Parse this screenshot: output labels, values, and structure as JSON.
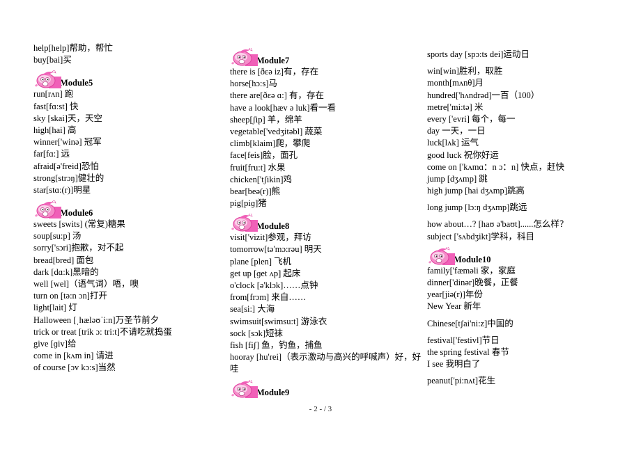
{
  "columns": [
    {
      "blocks": [
        {
          "type": "entries",
          "items": [
            "help[help]帮助，帮忙",
            "buy[bai]买"
          ]
        },
        {
          "type": "module",
          "title": "Module5",
          "items": [
            "run[rʌn]  跑",
            "fast[fɑ:st]  快",
            "sky [skai]天，天空",
            "high[hai]  高",
            "winner['winə]  冠军",
            "far[fɑ:]  远",
            "afraid[ə'freid]恐怕",
            "strong[strɔŋ]健壮的",
            "star[stɑ:(r)]明星"
          ]
        },
        {
          "type": "module",
          "title": "Module6",
          "items": [
            "sweets [swits] (常复)糖果",
            "soup[su:p]  汤",
            "sorry['sɔri]抱歉，对不起",
            "bread[bred]  面包",
            "dark [dɑ:k]黑暗的",
            "well [wel]（语气词）唔，噢",
            "turn on [tə:n ɔn]打开",
            "light[lait]  灯",
            "Halloween [ˌhæləʊˈi:n]万圣节前夕",
            "trick or treat [trik ɔ: tri:t]不请吃就捣蛋",
            "give [ɡiv]给",
            "come in [kʌm in]  请进",
            "of course [ɔv    kɔ:s]当然"
          ]
        }
      ]
    },
    {
      "blocks": [
        {
          "type": "module",
          "title": "Module7",
          "items": [
            "there is [ðɛə iz]有，存在",
            "horse[hɔ:s]马",
            "there are[ðɛə ɑ:]  有，存在",
            "have a look[hæv ə luk]看一看",
            "sheep[ʃip]  羊，绵羊",
            "vegetable['vedʒitəbl]  蔬菜",
            "climb[klaim]爬，攀爬",
            "face[feis]脸，面孔",
            "fruit[fru:t]  水果",
            "chicken['tʃikin]鸡",
            "bear[beə(r)]熊",
            "pig[piɡ]猪"
          ]
        },
        {
          "type": "module",
          "title": "Module8",
          "items": [
            "visit['vizit]参观，拜访",
            "tomorrow[tə'mɔ:rəu]  明天",
            "plane [plen]  飞机",
            "get up [ɡet ʌp]  起床",
            "o'clock  [ə'klɔk]……点钟",
            "from[frɔm]  来自……",
            "sea[si:]  大海",
            "swimsuit[swimsu:t]  游泳衣",
            "sock [sɔk]短袜",
            "fish [fiʃ]  鱼，钓鱼，捕鱼",
            "hooray [hu'rei]（表示激动与高兴的呼喊声）好，好哇"
          ]
        },
        {
          "type": "module",
          "title": "Module9",
          "items": []
        }
      ]
    },
    {
      "blocks": [
        {
          "type": "entries",
          "items": [
            "sports day [spɔ:ts    dei]运动日"
          ]
        },
        {
          "type": "entries",
          "items": [
            "win[win]胜利，取胜",
            "month[mʌnθ]月",
            "hundred['hʌndrəd]一百（100）",
            "metre['mi:tə]  米",
            "every ['evri]  每个，每一",
            "day 一天，一日",
            "luck[lʌk]  运气",
            "good luck 祝你好运",
            "come on ['kʌmɑ：n    ɔ：n]  快点，赶快",
            "jump [dʒʌmp]  跳",
            "high jump [hai dʒʌmp]跳高"
          ]
        },
        {
          "type": "entries",
          "items": [
            "long jump [lɔ:ŋ dʒʌmp]跳远"
          ]
        },
        {
          "type": "entries",
          "items": [
            "how about…? [haʊ ə'baʊt]......怎么样？",
            "subject ['sʌbdʒikt]学科，科目"
          ]
        },
        {
          "type": "module",
          "title": "Module10",
          "items": [
            "family['fæməli 家，家庭",
            "dinner['dinər]晚餐，正餐",
            "year[jiə(r)]年份",
            "New Year 新年"
          ]
        },
        {
          "type": "entries",
          "items": [
            "Chinese[tʃai'ni:z]中国的"
          ]
        },
        {
          "type": "entries",
          "items": [
            "festival['festivl]节日",
            "the spring festival 春节",
            "I see 我明白了"
          ]
        },
        {
          "type": "entries",
          "items": [
            "peanut['pi:nʌt]花生"
          ]
        }
      ]
    }
  ],
  "module_icon": "pink-apple-cartoon-icon",
  "colors": {
    "icon_pink": "#f060b8",
    "icon_light": "#fbc4e4"
  },
  "footer": {
    "page_indicator": "- 2 -  / 3"
  }
}
